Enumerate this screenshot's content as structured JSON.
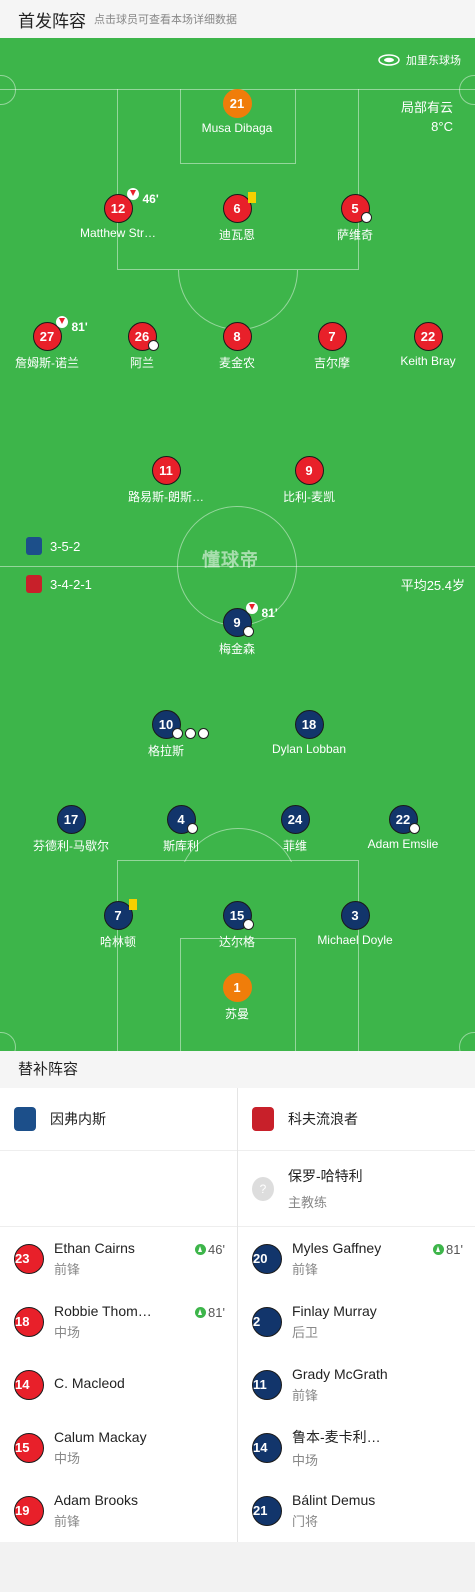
{
  "header": {
    "title": "首发阵容",
    "subtitle": "点击球员可查看本场详细数据"
  },
  "venue": {
    "stadium": "加里东球场",
    "weather": "局部有云",
    "temperature": "8°C"
  },
  "home": {
    "formation": "3-5-2",
    "players": [
      {
        "num": "21",
        "name": "Musa Dibaga",
        "gk": true
      },
      {
        "num": "12",
        "name": "Matthew Str…",
        "sub_off": "46'"
      },
      {
        "num": "6",
        "name": "迪瓦恩",
        "yellow": true
      },
      {
        "num": "5",
        "name": "萨维奇",
        "goal": true
      },
      {
        "num": "27",
        "name": "詹姆斯-诺兰",
        "sub_off": "81'"
      },
      {
        "num": "26",
        "name": "阿兰",
        "assist": true
      },
      {
        "num": "8",
        "name": "麦金农"
      },
      {
        "num": "7",
        "name": "吉尔摩"
      },
      {
        "num": "22",
        "name": "Keith Bray"
      },
      {
        "num": "11",
        "name": "路易斯-朗斯…"
      },
      {
        "num": "9",
        "name": "比利-麦凯"
      }
    ]
  },
  "away": {
    "formation": "3-4-2-1",
    "avg_age": "平均25.4岁",
    "players": [
      {
        "num": "9",
        "name": "梅金森",
        "sub_off": "81'",
        "goal": true
      },
      {
        "num": "10",
        "name": "格拉斯"
      },
      {
        "num": "18",
        "name": "Dylan Lobban"
      },
      {
        "num": "17",
        "name": "芬德利-马歇尔"
      },
      {
        "num": "4",
        "name": "斯库利"
      },
      {
        "num": "24",
        "name": "菲维"
      },
      {
        "num": "22",
        "name": "Adam Emslie"
      },
      {
        "num": "7",
        "name": "哈林顿",
        "yellow": true
      },
      {
        "num": "15",
        "name": "达尔格"
      },
      {
        "num": "3",
        "name": "Michael Doyle"
      },
      {
        "num": "1",
        "name": "苏曼",
        "gk": true
      }
    ]
  },
  "watermark": "懂球帝",
  "subs": {
    "title": "替补阵容",
    "home_team": "因弗内斯",
    "away_team": "科夫流浪者",
    "away_coach": {
      "name": "保罗-哈特利",
      "role": "主教练"
    },
    "home_list": [
      {
        "num": "23",
        "name": "Ethan Cairns",
        "pos": "前锋",
        "min": "46'"
      },
      {
        "num": "18",
        "name": "Robbie Thom…",
        "pos": "中场",
        "min": "81'"
      },
      {
        "num": "14",
        "name": "C. Macleod",
        "pos": "",
        "min": ""
      },
      {
        "num": "15",
        "name": "Calum Mackay",
        "pos": "中场",
        "min": ""
      },
      {
        "num": "19",
        "name": "Adam Brooks",
        "pos": "前锋",
        "min": ""
      }
    ],
    "away_list": [
      {
        "num": "20",
        "name": "Myles Gaffney",
        "pos": "前锋",
        "min": "81'"
      },
      {
        "num": "2",
        "name": "Finlay Murray",
        "pos": "后卫",
        "min": ""
      },
      {
        "num": "11",
        "name": "Grady McGrath",
        "pos": "前锋",
        "min": ""
      },
      {
        "num": "14",
        "name": "鲁本-麦卡利…",
        "pos": "中场",
        "min": ""
      },
      {
        "num": "21",
        "name": "Bálint Demus",
        "pos": "门将",
        "min": ""
      }
    ]
  },
  "colors": {
    "pitch": "#3db54a",
    "home": "#e8202a",
    "away": "#12356b",
    "keeper": "#f07d0a"
  }
}
